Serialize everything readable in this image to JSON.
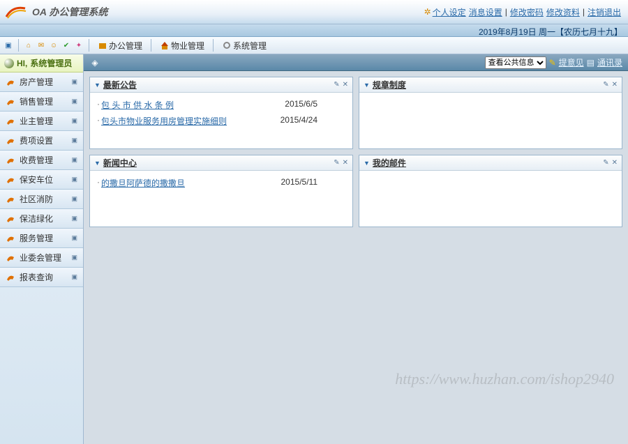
{
  "header": {
    "system_name": "OA 办公管理系统",
    "links": {
      "personal_settings": "个人设定",
      "message_settings": "消息设置",
      "change_password": "修改密码",
      "change_profile": "修改资料",
      "logout": "注销退出"
    },
    "date_text": "2019年8月19日 周一【农历七月十九】"
  },
  "toolbar": {
    "menus": [
      {
        "label": "办公管理",
        "icon": "office"
      },
      {
        "label": "物业管理",
        "icon": "property"
      },
      {
        "label": "系统管理",
        "icon": "system"
      }
    ]
  },
  "sidebar": {
    "greeting_prefix": "HI,",
    "greeting_user": "系统管理员",
    "items": [
      {
        "label": "房产管理"
      },
      {
        "label": "销售管理"
      },
      {
        "label": "业主管理"
      },
      {
        "label": "费项设置"
      },
      {
        "label": "收费管理"
      },
      {
        "label": "保安车位"
      },
      {
        "label": "社区消防"
      },
      {
        "label": "保洁绿化"
      },
      {
        "label": "服务管理"
      },
      {
        "label": "业委会管理"
      },
      {
        "label": "报表查询"
      }
    ]
  },
  "main_top": {
    "dropdown_label": "查看公共信息",
    "link_suggest": "提意见",
    "link_contacts": "通讯录"
  },
  "panels": {
    "announcements": {
      "title": "最新公告",
      "rows": [
        {
          "text": "包 头 市 供 水 条 例",
          "date": "2015/6/5"
        },
        {
          "text": "包头市物业服务用房管理实施细则",
          "date": "2015/4/24"
        }
      ]
    },
    "rules": {
      "title": "规章制度"
    },
    "news": {
      "title": "新闻中心",
      "rows": [
        {
          "text": "的撒旦阿萨德的撒撒旦",
          "date": "2015/5/11"
        }
      ]
    },
    "mail": {
      "title": "我的邮件"
    }
  },
  "watermark": "https://www.huzhan.com/ishop2940"
}
